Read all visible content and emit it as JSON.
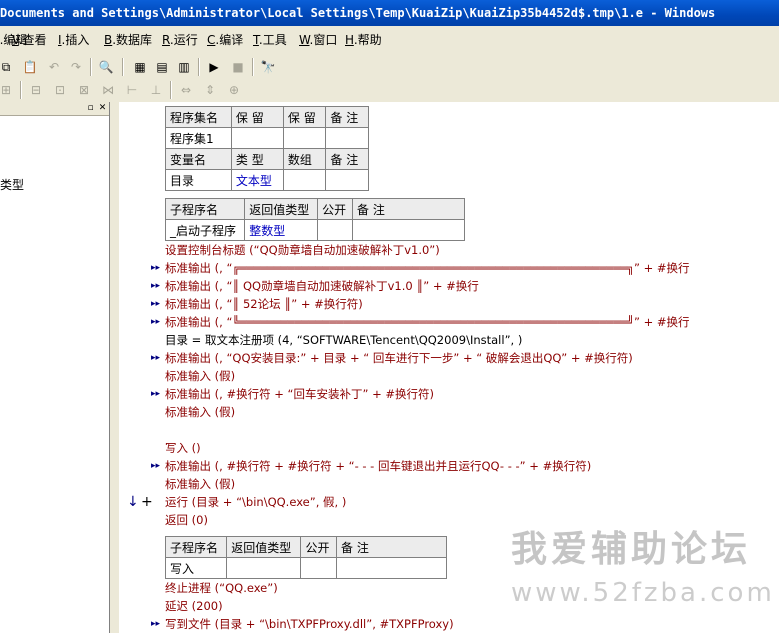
{
  "window": {
    "title": "Documents and Settings\\Administrator\\Local Settings\\Temp\\KuaiZip\\KuaiZip35b4452d$.tmp\\1.e - Windows"
  },
  "menu": [
    {
      "key": "E",
      "label": ".编辑"
    },
    {
      "key": "V",
      "label": ".查看"
    },
    {
      "key": "I",
      "label": ".插入"
    },
    {
      "key": "B",
      "label": ".数据库"
    },
    {
      "key": "R",
      "label": ".运行"
    },
    {
      "key": "C",
      "label": ".编译"
    },
    {
      "key": "T",
      "label": ".工具"
    },
    {
      "key": "W",
      "label": ".窗口"
    },
    {
      "key": "H",
      "label": ".帮助"
    }
  ],
  "left_panel": {
    "tree_item": "类型"
  },
  "assembly_table": {
    "headers": [
      "程序集名",
      "保 留",
      "保 留",
      "备 注"
    ],
    "row": [
      "程序集1",
      "",
      "",
      ""
    ],
    "var_headers": [
      "变量名",
      "类 型",
      "数组",
      "备 注"
    ],
    "var_row": [
      "目录",
      "文本型",
      "",
      ""
    ]
  },
  "sub1_table": {
    "headers": [
      "子程序名",
      "返回值类型",
      "公开",
      "备 注"
    ],
    "row": [
      "_启动子程序",
      "整数型",
      "",
      ""
    ]
  },
  "sub2_table": {
    "headers": [
      "子程序名",
      "返回值类型",
      "公开",
      "备 注"
    ],
    "row": [
      "写入",
      "",
      "",
      ""
    ]
  },
  "code": {
    "l1": "设置控制台标题 (“QQ勋章墙自动加速破解补丁v1.0”)",
    "l2": "标准输出 (, “╔════════════════════════════════════════════════════════╗” + #换行",
    "l3": "标准输出 (, “║                       QQ勋章墙自动加速破解补丁v1.0                      ║” + #换行",
    "l4": "标准输出 (, “║                                   52论坛                                ║” + #换行符)",
    "l5": "标准输出 (, “╚════════════════════════════════════════════════════════╝” + #换行",
    "l6": "目录 = 取文本注册项 (4, “SOFTWARE\\Tencent\\QQ2009\\Install”, )",
    "l7": "标准输出 (, “QQ安装目录:” + 目录 + “ 回车进行下一步” + “ 破解会退出QQ” + #换行符)",
    "l8": "标准输入 (假)",
    "l9": "标准输出 (, #换行符 + “回车安装补丁” + #换行符)",
    "l10": "标准输入 (假)",
    "l11": "写入 ()",
    "l12": "标准输出 (, #换行符 + #换行符 + “- - - 回车键退出并且运行QQ- - -” + #换行符)",
    "l13": "标准输入 (假)",
    "l14": "运行 (目录 + “\\bin\\QQ.exe”, 假, )",
    "l15": "返回 (0)",
    "l16": "终止进程 (“QQ.exe”)",
    "l17": "延迟 (200)",
    "l18": "写到文件 (目录 + “\\bin\\TXPFProxy.dll”, #TXPFProxy)"
  },
  "watermark": {
    "cn": "我爱辅助论坛",
    "url": "www.52fzba.com"
  }
}
